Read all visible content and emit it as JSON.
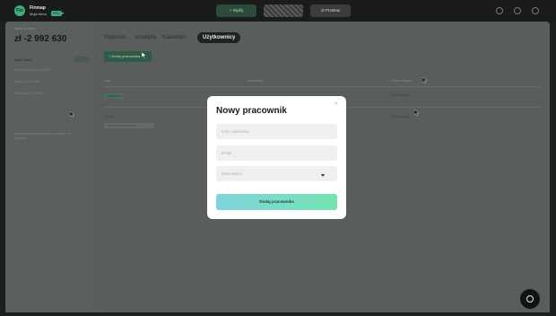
{
  "topbar": {
    "logo_text": "Fin",
    "app_name": "Finmap",
    "company": "Moja firma",
    "plan": "PRO",
    "send_label": "+ Wyślij",
    "receive_label": "⇄ Przelew"
  },
  "left": {
    "caption": "Saldo na dzień",
    "balance": "zł -2 992 630",
    "section": "Moje konta",
    "pill": "Zarządzaj",
    "accounts": [
      "Konto bieżące  zł -500 000",
      "Bank  zł -2 400 630",
      "Gotówka  zł -107 000"
    ],
    "hint": "W chwili obecnej nie masz uprawnień do płatności"
  },
  "main": {
    "tabs": [
      "Płatności",
      "Analityka",
      "Kalendarz",
      "Użytkownicy"
    ],
    "active_tab": "Użytkownicy",
    "add_button": "+ Dodaj pracownika",
    "columns": [
      "Imię",
      "Stanowisko",
      "Prawo dostępu"
    ],
    "rows": [
      {
        "role": "Właściciel",
        "access": "Pełny dostęp"
      },
      {
        "name": "Kolega",
        "permission": "Uprawnienia do płatności",
        "access": "Pełny dostęp"
      }
    ]
  },
  "modal": {
    "title": "Nowy pracownik",
    "close": "×",
    "name_placeholder": "Imię i nazwisko",
    "email_placeholder": "Email",
    "position_placeholder": "Stanowisko",
    "submit_label": "Dodaj pracownika"
  },
  "colors": {
    "accent": "#3fae7d",
    "overlay": "#595e5c",
    "modal_bg": "#ffffff",
    "submit_from": "#7fd3dc",
    "submit_to": "#76e3b2"
  }
}
